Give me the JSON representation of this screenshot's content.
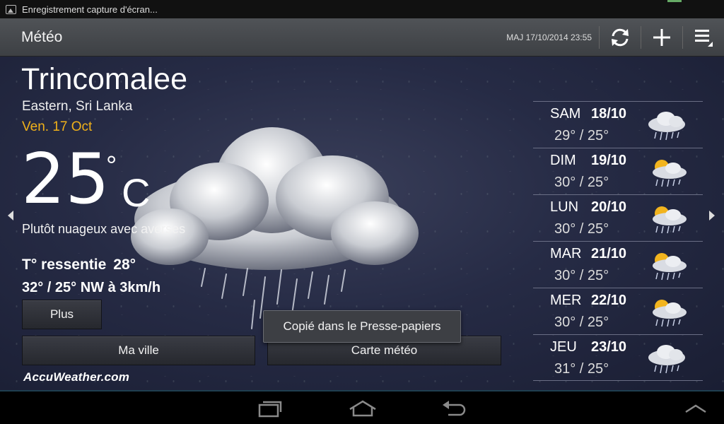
{
  "statusbar": {
    "notification": "Enregistrement capture d'écran..."
  },
  "header": {
    "title": "Météo",
    "updated": "MAJ 17/10/2014 23:55"
  },
  "current": {
    "city": "Trincomalee",
    "region": "Eastern, Sri Lanka",
    "date": "Ven. 17 Oct",
    "temperature": "25",
    "degree_symbol": "°",
    "unit": "C",
    "condition": "Plutôt nuageux avec averses",
    "feels_label": "T° ressentie",
    "feels_value": "28°",
    "minmax_wind": "32°  / 25° NW à 3km/h"
  },
  "buttons": {
    "more": "Plus",
    "my_city": "Ma ville",
    "map": "Carte météo"
  },
  "brand": "AccuWeather.com",
  "toast": "Copié dans le Presse-papiers",
  "forecast": [
    {
      "day": "SAM",
      "date": "18/10",
      "temps": "29° / 25°",
      "icon": "cloud-rain-icon"
    },
    {
      "day": "DIM",
      "date": "19/10",
      "temps": "30° / 25°",
      "icon": "sun-cloud-rain-icon"
    },
    {
      "day": "LUN",
      "date": "20/10",
      "temps": "30° / 25°",
      "icon": "sun-cloud-rain-icon"
    },
    {
      "day": "MAR",
      "date": "21/10",
      "temps": "30° / 25°",
      "icon": "sun-cloud-rain-icon"
    },
    {
      "day": "MER",
      "date": "22/10",
      "temps": "30° / 25°",
      "icon": "sun-cloud-rain-icon"
    },
    {
      "day": "JEU",
      "date": "23/10",
      "temps": "31° / 25°",
      "icon": "cloud-rain-icon"
    }
  ],
  "colors": {
    "accent_date": "#f0b11a",
    "background": "#262b45"
  }
}
